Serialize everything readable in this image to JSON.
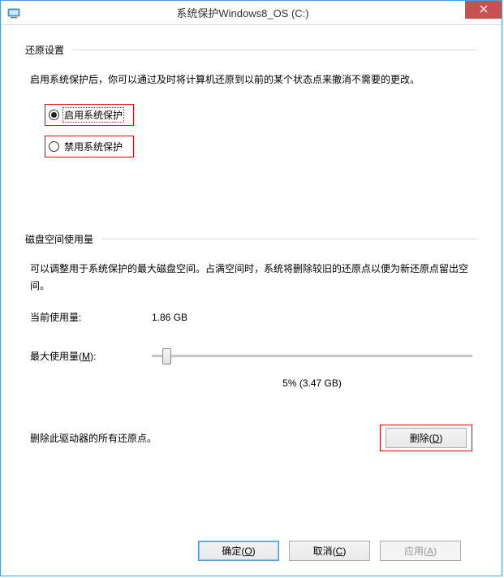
{
  "title": "系统保护Windows8_OS (C:)",
  "sections": {
    "restore": {
      "header": "还原设置",
      "desc": "启用系统保护后，你可以通过及时将计算机还原到以前的某个状态点来撤消不需要的更改。",
      "options": {
        "enable": "启用系统保护",
        "disable": "禁用系统保护"
      }
    },
    "disk": {
      "header": "磁盘空间使用量",
      "desc": "可以调整用于系统保护的最大磁盘空间。占满空间时，系统将删除较旧的还原点以便为新还原点留出空间。",
      "current_label": "当前使用量:",
      "current_value": "1.86 GB",
      "max_label_prefix": "最大使用量(",
      "max_label_hot": "M",
      "max_label_suffix": "):",
      "slider_value": "5% (3.47 GB)",
      "delete_label": "删除此驱动器的所有还原点。",
      "delete_btn_prefix": "删除(",
      "delete_btn_hot": "D",
      "delete_btn_suffix": ")"
    }
  },
  "footer": {
    "ok_prefix": "确定(",
    "ok_hot": "O",
    "ok_suffix": ")",
    "cancel_prefix": "取消(",
    "cancel_hot": "C",
    "cancel_suffix": ")",
    "apply_prefix": "应用(",
    "apply_hot": "A",
    "apply_suffix": ")"
  }
}
